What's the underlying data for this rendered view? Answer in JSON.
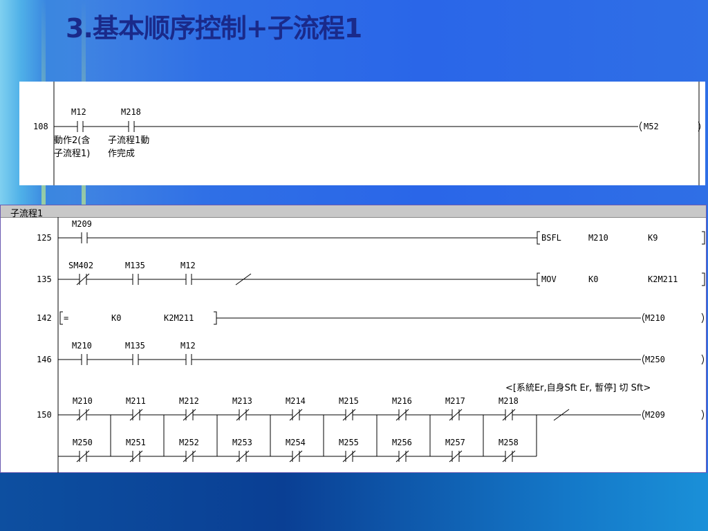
{
  "title": "3.基本顺序控制+子流程1",
  "panel1": {
    "rung": {
      "step": "108",
      "contact1": "M12",
      "contact2": "M218",
      "coil": "M52",
      "comment1_line1": "動作2(含",
      "comment1_line2": "子流程1)",
      "comment2_line1": "子流程1動",
      "comment2_line2": "作完成"
    }
  },
  "panel2": {
    "tab": "子流程1",
    "rung125": {
      "step": "125",
      "contact": "M209",
      "instr": "BSFL",
      "op1": "M210",
      "op2": "K9"
    },
    "rung135": {
      "step": "135",
      "c1": "SM402",
      "c2": "M135",
      "c3": "M12",
      "instr": "MOV",
      "op1": "K0",
      "op2": "K2M211"
    },
    "rung142": {
      "step": "142",
      "cmp": "=",
      "op1": "K0",
      "op2": "K2M211",
      "coil": "M210"
    },
    "rung146": {
      "step": "146",
      "c1": "M210",
      "c2": "M135",
      "c3": "M12",
      "coil": "M250"
    },
    "rung150": {
      "step": "150",
      "comment": "<[系統Er,自身Sft Er, 暫停] 切 Sft>",
      "row1": [
        "M210",
        "M211",
        "M212",
        "M213",
        "M214",
        "M215",
        "M216",
        "M217",
        "M218"
      ],
      "row2": [
        "M250",
        "M251",
        "M252",
        "M253",
        "M254",
        "M255",
        "M256",
        "M257",
        "M258"
      ],
      "coil": "M209"
    }
  }
}
